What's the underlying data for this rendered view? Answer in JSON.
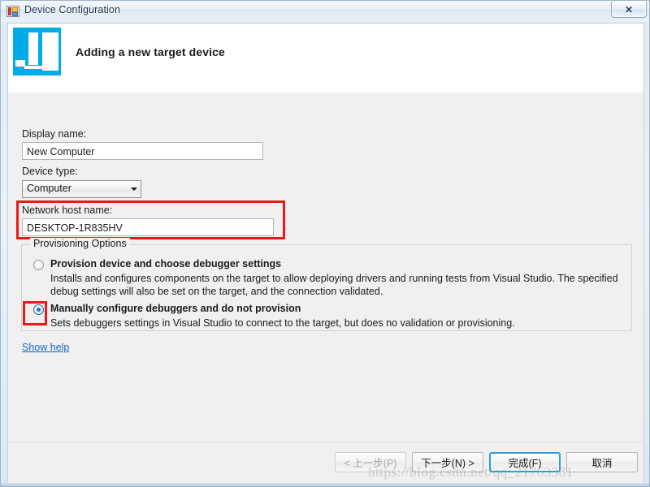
{
  "window": {
    "title": "Device Configuration",
    "icon": "window-form-icon",
    "close_label": "✕"
  },
  "header": {
    "icon": "device-computer-tablet-icon",
    "title": "Adding a new target device"
  },
  "form": {
    "display_name": {
      "label": "Display name:",
      "value": "New Computer"
    },
    "device_type": {
      "label": "Device type:",
      "value": "Computer",
      "arrow_icon": "chevron-down-icon"
    },
    "network_host_name": {
      "label": "Network host name:",
      "value": "DESKTOP-1R835HV"
    }
  },
  "provisioning": {
    "legend": "Provisioning Options",
    "options": [
      {
        "title": "Provision device and choose debugger settings",
        "description": "Installs and configures components on the target to allow deploying drivers and running tests from Visual Studio. The specified debug settings will also be set on the target, and the connection validated.",
        "selected": false
      },
      {
        "title": "Manually configure debuggers and do not provision",
        "description": "Sets debuggers settings in Visual Studio to connect to the target, but does no validation or provisioning.",
        "selected": true
      }
    ]
  },
  "help_link": "Show help",
  "footer": {
    "back_label": "< 上一步(P)",
    "next_label": "下一步(N) >",
    "finish_label": "完成(F)",
    "cancel_label": "取消"
  },
  "watermark": "https://blog.csdn.net/qq_21763381",
  "colors": {
    "accent": "#00ace8",
    "annotation": "#e81b17",
    "link": "#1667c6",
    "default_button_border": "#2a9fd6"
  }
}
